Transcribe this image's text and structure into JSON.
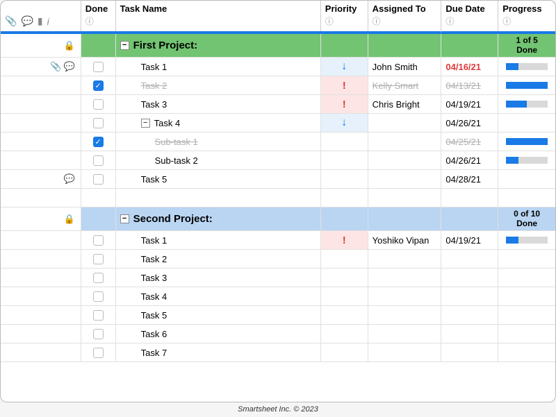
{
  "footer": "Smartsheet Inc. © 2023",
  "header": {
    "done": "Done",
    "task": "Task Name",
    "priority": "Priority",
    "assigned": "Assigned To",
    "due": "Due Date",
    "progress": "Progress"
  },
  "sections": [
    {
      "color": "green",
      "title": "First Project:",
      "locked": true,
      "progress_summary": "1 of 5 Done",
      "rows": [
        {
          "icons": [
            "attach",
            "comment"
          ],
          "done": false,
          "task": "Task 1",
          "indent": 1,
          "priority": "low",
          "assigned": "John Smith",
          "due": "04/16/21",
          "due_state": "late",
          "progress": 30
        },
        {
          "icons": [],
          "done": true,
          "task": "Task 2",
          "indent": 1,
          "priority": "high",
          "assigned": "Kelly Smart",
          "due": "04/13/21",
          "due_state": "strike",
          "progress": 100,
          "strike": true
        },
        {
          "icons": [],
          "done": false,
          "task": "Task 3",
          "indent": 1,
          "priority": "high",
          "assigned": "Chris Bright",
          "due": "04/19/21",
          "due_state": "norm",
          "progress": 50
        },
        {
          "icons": [],
          "done": false,
          "task": "Task 4",
          "indent": 1,
          "priority": "low",
          "assigned": "",
          "due": "04/26/21",
          "due_state": "norm",
          "expand": true
        },
        {
          "icons": [],
          "done": true,
          "task": "Sub-task 1",
          "indent": 2,
          "assigned": "",
          "due": "04/25/21",
          "due_state": "strike",
          "progress": 100,
          "strike": true
        },
        {
          "icons": [],
          "done": false,
          "task": "Sub-task 2",
          "indent": 2,
          "assigned": "",
          "due": "04/26/21",
          "due_state": "norm",
          "progress": 30
        },
        {
          "icons": [
            "comment"
          ],
          "done": false,
          "task": "Task 5",
          "indent": 1,
          "assigned": "",
          "due": "04/28/21",
          "due_state": "norm"
        }
      ]
    },
    {
      "color": "blue",
      "title": "Second Project:",
      "locked": true,
      "progress_summary": "0 of 10 Done",
      "rows": [
        {
          "done": false,
          "task": "Task 1",
          "indent": 1,
          "priority": "high",
          "assigned": "Yoshiko Vipan",
          "due": "04/19/21",
          "due_state": "norm",
          "progress": 30
        },
        {
          "done": false,
          "task": "Task 2",
          "indent": 1
        },
        {
          "done": false,
          "task": "Task 3",
          "indent": 1
        },
        {
          "done": false,
          "task": "Task 4",
          "indent": 1
        },
        {
          "done": false,
          "task": "Task 5",
          "indent": 1
        },
        {
          "done": false,
          "task": "Task 6",
          "indent": 1
        },
        {
          "done": false,
          "task": "Task 7",
          "indent": 1
        }
      ]
    }
  ]
}
